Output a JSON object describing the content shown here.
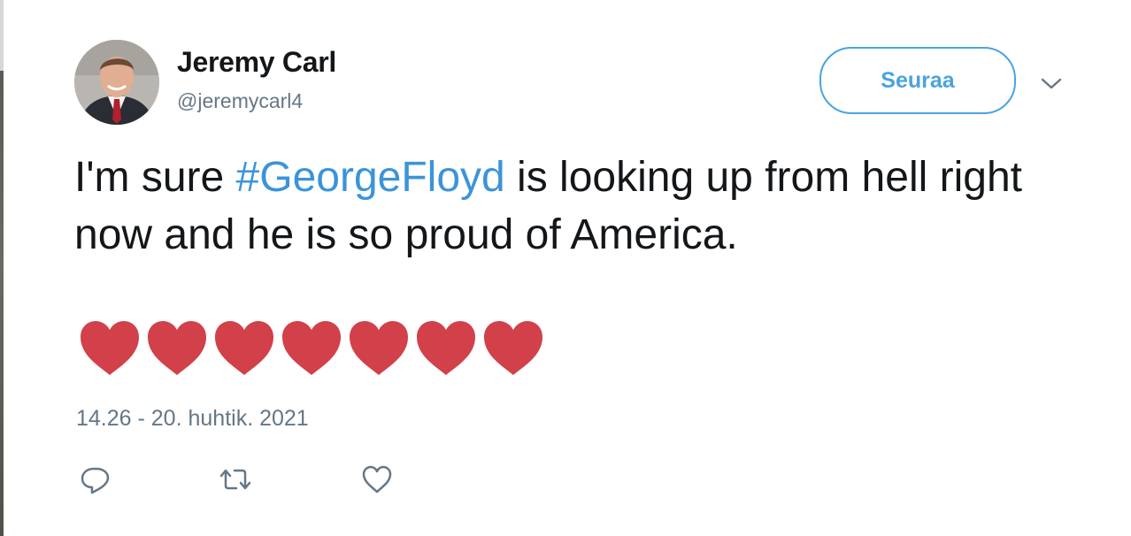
{
  "author": {
    "display_name": "Jeremy Carl",
    "handle": "@jeremycarl4",
    "avatar_icon": "profile-photo"
  },
  "follow_button": {
    "label": "Seuraa"
  },
  "more_menu": {
    "icon": "chevron-down-icon"
  },
  "tweet": {
    "text_prefix": "I'm sure ",
    "hashtag": "#GeorgeFloyd",
    "text_suffix": " is looking up from hell right now and he is so proud of America.",
    "heart_emoji_count": 7
  },
  "timestamp": "14.26 - 20. huhtik. 2021",
  "actions": [
    {
      "name": "reply",
      "icon": "reply-icon"
    },
    {
      "name": "retweet",
      "icon": "retweet-icon"
    },
    {
      "name": "like",
      "icon": "like-heart-icon"
    }
  ],
  "colors": {
    "accent": "#4aa3df",
    "hashtag": "#3b94d9",
    "heart": "#d2404a",
    "secondary_text": "#657786"
  }
}
